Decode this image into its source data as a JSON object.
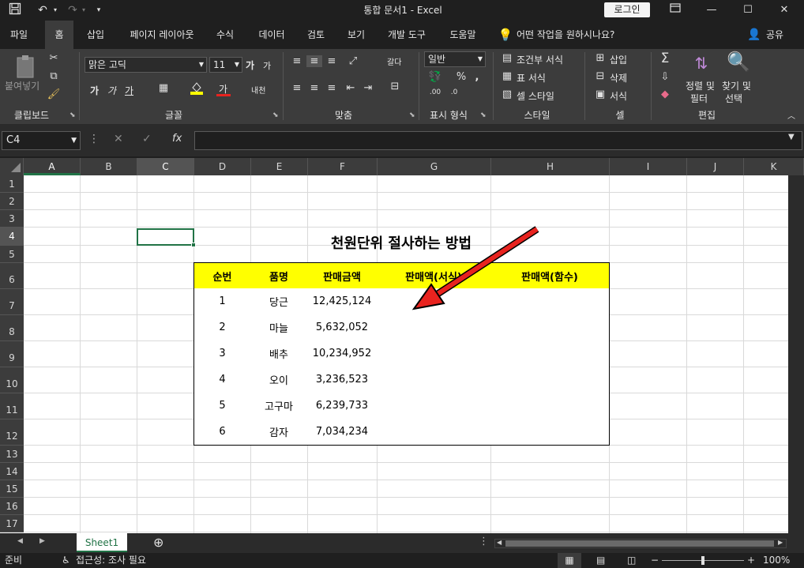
{
  "window": {
    "title": "통합 문서1  -  Excel",
    "login_label": "로그인",
    "qat": {
      "save_icon": "save-icon",
      "undo_icon": "undo-icon",
      "redo_icon": "redo-icon",
      "customize_icon": "chevron-down-icon"
    }
  },
  "ribbon_tabs": [
    "파일",
    "홈",
    "삽입",
    "페이지 레이아웃",
    "수식",
    "데이터",
    "검토",
    "보기",
    "개발 도구",
    "도움말"
  ],
  "active_tab": "홈",
  "tell_me": "어떤 작업을 원하시나요?",
  "share_label": "공유",
  "ribbon": {
    "clipboard": {
      "label": "클립보드",
      "paste": "붙여넣기"
    },
    "font": {
      "label": "글꼴",
      "font_name": "맑은 고딕",
      "font_size": "11",
      "bold": "가",
      "italic": "가",
      "underline": "가",
      "grow": "가",
      "shrink": "가",
      "font_color_glyph": "가",
      "phonetic": "내천"
    },
    "alignment": {
      "label": "맞춤",
      "wrap": "갈다"
    },
    "number": {
      "label": "표시 형식",
      "format": "일반"
    },
    "styles": {
      "label": "스타일",
      "conditional": "조건부 서식",
      "table": "표 서식",
      "cell_style": "셀 스타일"
    },
    "cells": {
      "label": "셀",
      "insert": "삽입",
      "delete": "삭제",
      "format": "서식"
    },
    "editing": {
      "label": "편집",
      "sort_line1": "정렬 및",
      "sort_line2": "필터",
      "find_line1": "찾기 및",
      "find_line2": "선택"
    }
  },
  "formula_bar": {
    "name_box": "C4",
    "fx": "fx",
    "value": ""
  },
  "columns": [
    "A",
    "B",
    "C",
    "D",
    "E",
    "F",
    "G",
    "H",
    "I",
    "J",
    "K"
  ],
  "rows": [
    "1",
    "2",
    "3",
    "4",
    "5",
    "6",
    "7",
    "8",
    "9",
    "10",
    "11",
    "12",
    "13",
    "14",
    "15",
    "16",
    "17"
  ],
  "sheet": {
    "title": "천원단위 절사하는 방법",
    "headers": [
      "순번",
      "품명",
      "판매금액",
      "판매액(서식)",
      "판매액(함수)"
    ],
    "rows": [
      [
        "1",
        "당근",
        "12,425,124",
        "",
        ""
      ],
      [
        "2",
        "마늘",
        "5,632,052",
        "",
        ""
      ],
      [
        "3",
        "배추",
        "10,234,952",
        "",
        ""
      ],
      [
        "4",
        "오이",
        "3,236,523",
        "",
        ""
      ],
      [
        "5",
        "고구마",
        "6,239,733",
        "",
        ""
      ],
      [
        "6",
        "감자",
        "7,034,234",
        "",
        ""
      ]
    ],
    "header_fill": "#ffff00",
    "arrow_color": "#e8231f"
  },
  "sheet_tabs": [
    "Sheet1"
  ],
  "status": {
    "ready": "준비",
    "accessibility": "접근성: 조사 필요",
    "zoom": "100%"
  },
  "accent": "#217346"
}
